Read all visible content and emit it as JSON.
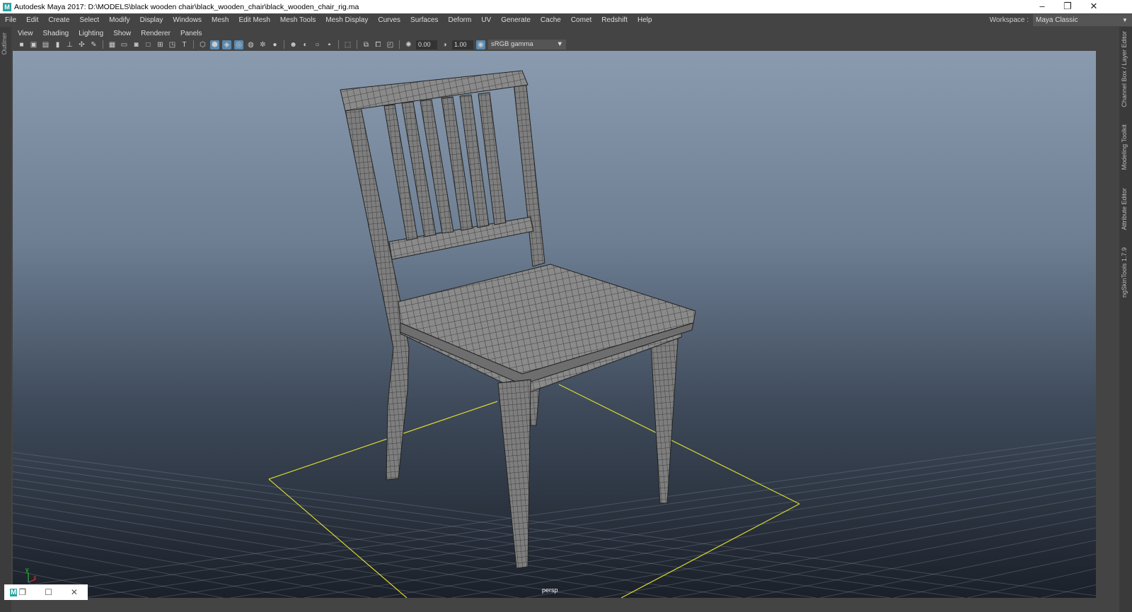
{
  "window": {
    "title": "Autodesk Maya 2017: D:\\MODELS\\black wooden chair\\black_wooden_chair\\black_wooden_chair_rig.ma",
    "logo": "M"
  },
  "menu": [
    "File",
    "Edit",
    "Create",
    "Select",
    "Modify",
    "Display",
    "Windows",
    "Mesh",
    "Edit Mesh",
    "Mesh Tools",
    "Mesh Display",
    "Curves",
    "Surfaces",
    "Deform",
    "UV",
    "Generate",
    "Cache",
    "Comet",
    "Redshift",
    "Help"
  ],
  "workspace": {
    "label": "Workspace :",
    "value": "Maya Classic"
  },
  "left_tab": "Outliner",
  "right_tabs": [
    "Channel Box / Layer Editor",
    "Modeling Toolkit",
    "Attribute Editor",
    "ngSkinTools 1.7.9"
  ],
  "panel_menu": [
    "View",
    "Shading",
    "Lighting",
    "Show",
    "Renderer",
    "Panels"
  ],
  "toolbar": {
    "exposure": "0.00",
    "gamma": "1.00",
    "color_space": "sRGB gamma"
  },
  "viewport": {
    "camera": "persp",
    "axis_y": "y",
    "axis_x": "x"
  },
  "accent": "#5a8ab0"
}
